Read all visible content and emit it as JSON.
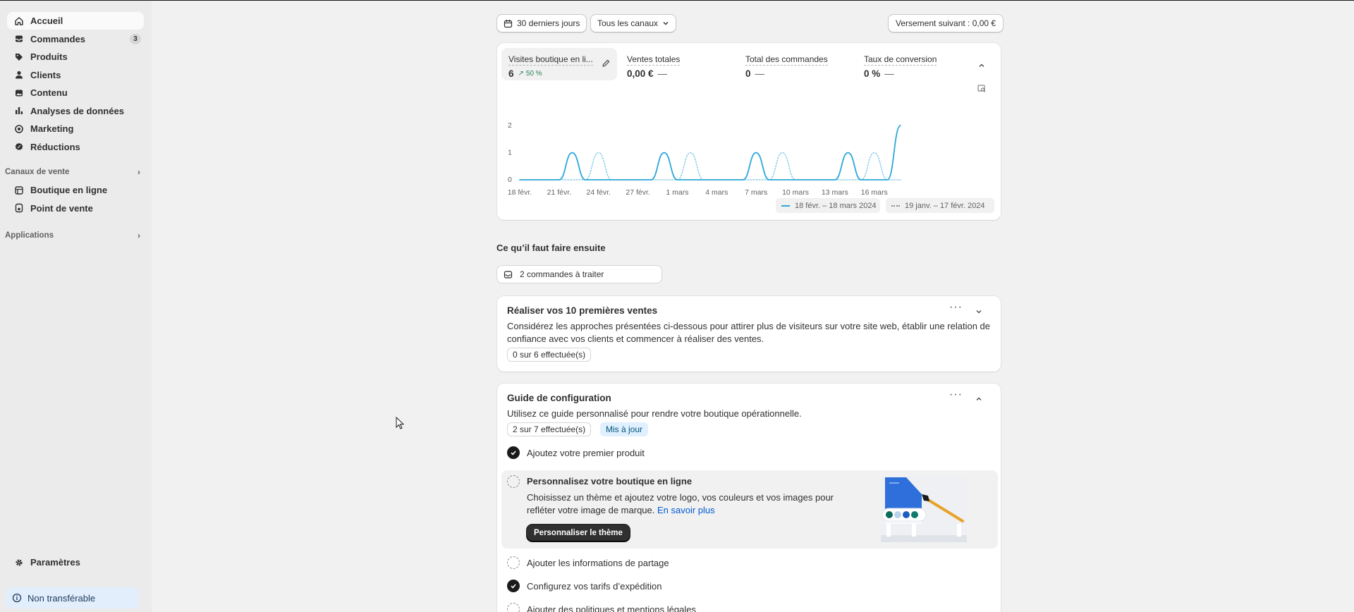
{
  "sidebar": {
    "items": [
      {
        "label": "Accueil",
        "icon": "home-icon",
        "active": true
      },
      {
        "label": "Commandes",
        "icon": "inbox-icon",
        "badge": "3"
      },
      {
        "label": "Produits",
        "icon": "tag-icon"
      },
      {
        "label": "Clients",
        "icon": "person-icon"
      },
      {
        "label": "Contenu",
        "icon": "image-icon"
      },
      {
        "label": "Analyses de données",
        "icon": "bar-chart-icon"
      },
      {
        "label": "Marketing",
        "icon": "target-icon"
      },
      {
        "label": "Réductions",
        "icon": "discount-icon"
      }
    ],
    "sales_channels_title": "Canaux de vente",
    "sales_channels": [
      {
        "label": "Boutique en ligne",
        "icon": "store-icon"
      },
      {
        "label": "Point de vente",
        "icon": "pos-icon"
      }
    ],
    "apps_title": "Applications",
    "settings_label": "Paramètres",
    "non_transferable_label": "Non transférable"
  },
  "toolbar": {
    "date_range": "30 derniers jours",
    "channels": "Tous les canaux",
    "payout": "Versement suivant : 0,00 €"
  },
  "metrics": [
    {
      "label": "Visites boutique en li...",
      "value": "6",
      "trend": "50 %"
    },
    {
      "label": "Ventes totales",
      "value": "0,00 €",
      "dash": "—"
    },
    {
      "label": "Total des commandes",
      "value": "0",
      "dash": "—"
    },
    {
      "label": "Taux de conversion",
      "value": "0 %",
      "dash": "—"
    }
  ],
  "chart_data": {
    "type": "line",
    "x": [
      "18 févr.",
      "19 févr.",
      "20 févr.",
      "21 févr.",
      "22 févr.",
      "23 févr.",
      "24 févr.",
      "25 févr.",
      "26 févr.",
      "27 févr.",
      "28 févr.",
      "29 févr.",
      "1 mars",
      "2 mars",
      "3 mars",
      "4 mars",
      "5 mars",
      "6 mars",
      "7 mars",
      "8 mars",
      "9 mars",
      "10 mars",
      "11 mars",
      "12 mars",
      "13 mars",
      "14 mars",
      "15 mars",
      "16 mars",
      "17 mars",
      "18 mars"
    ],
    "tick_labels": [
      "18 févr.",
      "21 févr.",
      "24 févr.",
      "27 févr.",
      "1 mars",
      "4 mars",
      "7 mars",
      "10 mars",
      "13 mars",
      "16 mars"
    ],
    "series": [
      {
        "name": "18 févr. – 18 mars 2024",
        "style": "solid",
        "color": "#2ea7d8",
        "values": [
          0,
          0,
          0,
          0,
          1,
          0,
          0,
          0,
          0,
          0,
          0,
          1,
          0,
          0,
          0,
          0,
          0,
          0,
          1,
          0,
          0,
          0,
          0,
          0,
          0,
          1,
          0,
          0,
          0,
          2
        ]
      },
      {
        "name": "19 janv. – 17 févr. 2024",
        "style": "dotted",
        "color": "#8fd0ea",
        "values": [
          0,
          0,
          0,
          0,
          0,
          0,
          1,
          0,
          0,
          0,
          0,
          0,
          0,
          1,
          0,
          0,
          0,
          0,
          0,
          0,
          1,
          0,
          0,
          0,
          0,
          0,
          0,
          1,
          0,
          0
        ]
      }
    ],
    "yticks": [
      "0",
      "1",
      "2"
    ],
    "ylim": [
      0,
      2
    ]
  },
  "next_steps": {
    "title": "Ce qu’il faut faire ensuite",
    "orders_button": "2 commandes à traiter"
  },
  "first_sales": {
    "title": "Réaliser vos 10 premières ventes",
    "text_line1": "Considérez les approches présentées ci-dessous pour attirer plus de visiteurs sur votre site web, établir une relation de",
    "text_line2": "confiance avec vos clients et commencer à réaliser des ventes.",
    "progress": "0 sur 6 effectuée(s)"
  },
  "setup_guide": {
    "title": "Guide de configuration",
    "text": "Utilisez ce guide personnalisé pour rendre votre boutique opérationnelle.",
    "progress": "2 sur 7 effectuée(s)",
    "updated_badge": "Mis à jour",
    "tasks": [
      {
        "label": "Ajoutez votre premier produit",
        "done": true
      },
      {
        "label": "Personnalisez votre boutique en ligne",
        "done": false,
        "expanded": true,
        "desc_line1": "Choisissez un thème et ajoutez votre logo, vos couleurs et vos images pour",
        "desc_line2": "refléter votre image de marque.",
        "link": "En savoir plus",
        "button": "Personnaliser le thème"
      },
      {
        "label": "Ajouter les informations de partage",
        "done": false
      },
      {
        "label": "Configurez vos tarifs d’expédition",
        "done": true
      },
      {
        "label": "Ajouter des politiques et mentions légales",
        "done": false
      }
    ]
  }
}
